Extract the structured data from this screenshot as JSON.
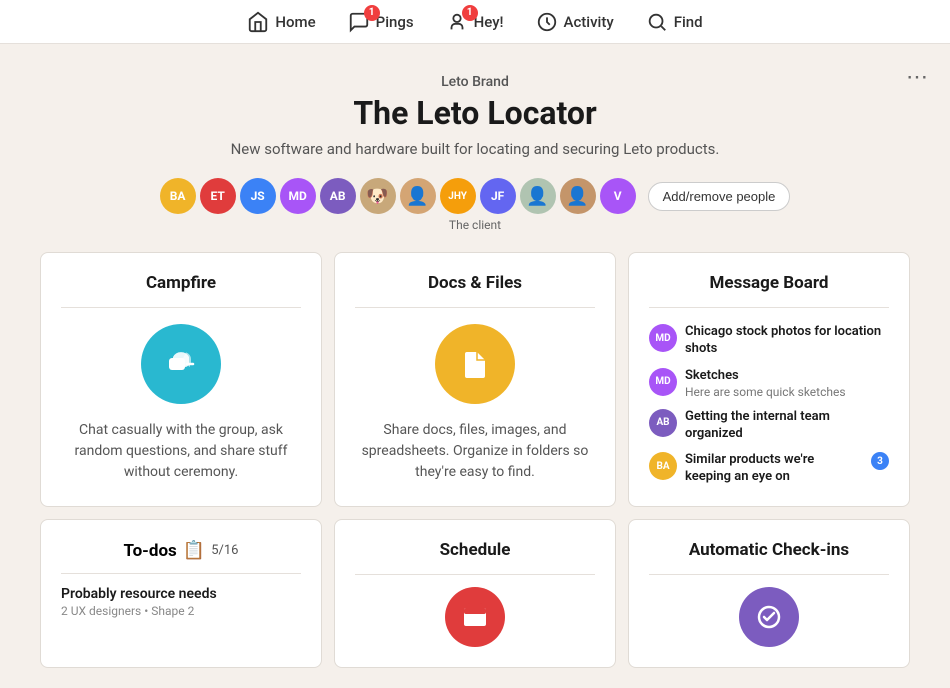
{
  "nav": {
    "items": [
      {
        "label": "Home",
        "icon": "home-icon",
        "badge": null
      },
      {
        "label": "Pings",
        "icon": "pings-icon",
        "badge": "1"
      },
      {
        "label": "Hey!",
        "icon": "hey-icon",
        "badge": "1"
      },
      {
        "label": "Activity",
        "icon": "activity-icon",
        "badge": null
      },
      {
        "label": "Find",
        "icon": "find-icon",
        "badge": null
      }
    ]
  },
  "project": {
    "brand": "Leto Brand",
    "title": "The Leto Locator",
    "description": "New software and hardware built for locating and securing Leto products.",
    "client_label": "The client",
    "add_people_label": "Add/remove people"
  },
  "avatars": [
    {
      "initials": "BA",
      "color": "#f0b429",
      "type": "initials"
    },
    {
      "initials": "ET",
      "color": "#e03c3c",
      "type": "initials"
    },
    {
      "initials": "JS",
      "color": "#3b82f6",
      "type": "initials"
    },
    {
      "initials": "MD",
      "color": "#a855f7",
      "type": "initials"
    },
    {
      "initials": "AB",
      "color": "#7c5cbf",
      "type": "initials"
    },
    {
      "initials": "dog",
      "color": "#ddd",
      "type": "photo",
      "index": 5
    },
    {
      "initials": "person1",
      "color": "#ddd",
      "type": "photo",
      "index": 6
    },
    {
      "initials": "JHY",
      "color": "#f59e0b",
      "type": "initials"
    },
    {
      "initials": "JF",
      "color": "#6366f1",
      "type": "initials"
    },
    {
      "initials": "person2",
      "color": "#ddd",
      "type": "photo",
      "index": 9
    },
    {
      "initials": "person3",
      "color": "#ddd",
      "type": "photo",
      "index": 10
    },
    {
      "initials": "V",
      "color": "#a855f7",
      "type": "initials"
    }
  ],
  "campfire": {
    "title": "Campfire",
    "body": "Chat casually with the group, ask random questions, and share stuff without ceremony."
  },
  "docs": {
    "title": "Docs & Files",
    "body": "Share docs, files, images, and spreadsheets. Organize in folders so they're easy to find."
  },
  "message_board": {
    "title": "Message Board",
    "items": [
      {
        "initials": "MD",
        "color": "#a855f7",
        "title": "Chicago stock photos for location shots",
        "sub": null,
        "badge": null
      },
      {
        "initials": "MD",
        "color": "#a855f7",
        "title": "Sketches",
        "sub": "Here are some quick sketches",
        "badge": null
      },
      {
        "initials": "AB",
        "color": "#7c5cbf",
        "title": "Getting the internal team organized",
        "sub": null,
        "badge": null
      },
      {
        "initials": "BA",
        "color": "#f0b429",
        "title": "Similar products we're keeping an eye on",
        "sub": null,
        "badge": "3"
      }
    ]
  },
  "todos": {
    "title": "To-dos",
    "progress": "5/16",
    "item_title": "Probably resource needs",
    "item_sub": "2 UX designers • Shape 2"
  },
  "schedule": {
    "title": "Schedule"
  },
  "checkins": {
    "title": "Automatic Check-ins"
  },
  "more_button": "⋯"
}
